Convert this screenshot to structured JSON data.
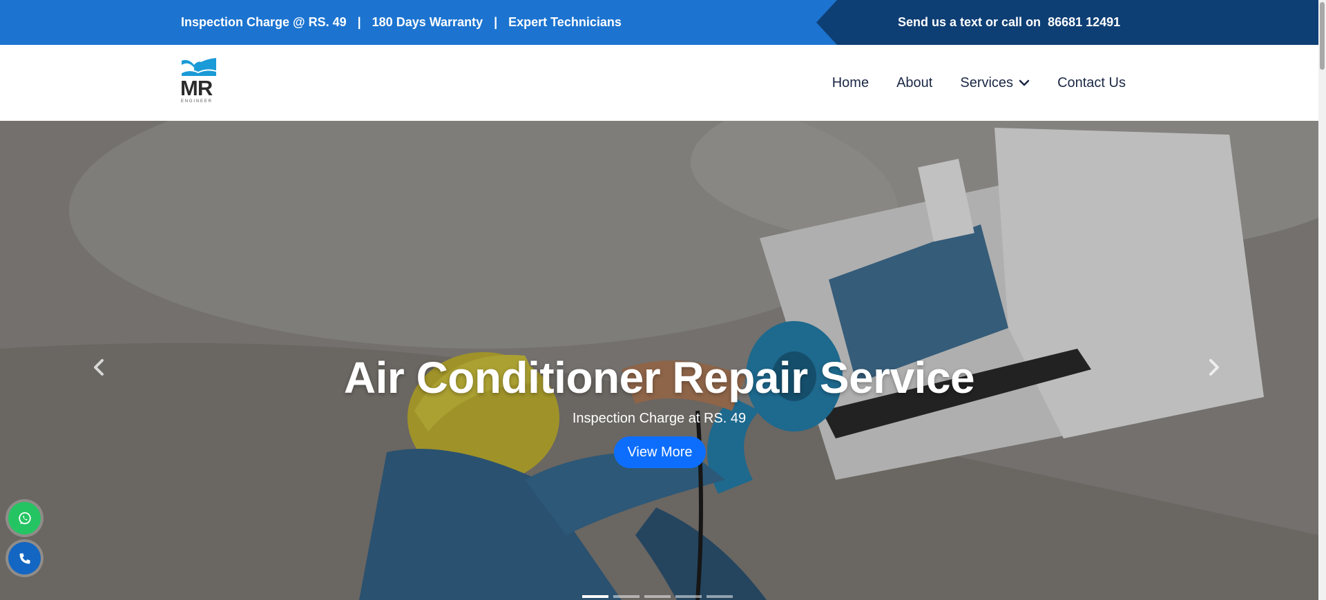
{
  "topbar": {
    "items": [
      "Inspection Charge @ RS. 49",
      "180 Days Warranty",
      "Expert Technicians"
    ],
    "separator": "|",
    "call_text": "Send us a text or call on",
    "phone": "86681 12491"
  },
  "header": {
    "logo": {
      "letters": "MR",
      "tagline": "ENGINEER"
    },
    "nav": [
      "Home",
      "About",
      "Services",
      "Contact Us"
    ]
  },
  "hero": {
    "title": "Air Conditioner Repair Service",
    "subtitle": "Inspection Charge at RS. 49",
    "cta": "View More",
    "slides": 5,
    "active_slide": 1
  },
  "icons": {
    "prev": "chevron-left-icon",
    "next": "chevron-right-icon",
    "whatsapp": "whatsapp-icon",
    "call": "phone-icon",
    "services_dropdown": "chevron-down-icon"
  },
  "colors": {
    "topbar": "#1c74d0",
    "topbar_right": "#0e3f74",
    "accent": "#0d6efd",
    "whatsapp": "#25c463",
    "call": "#1366c2"
  }
}
